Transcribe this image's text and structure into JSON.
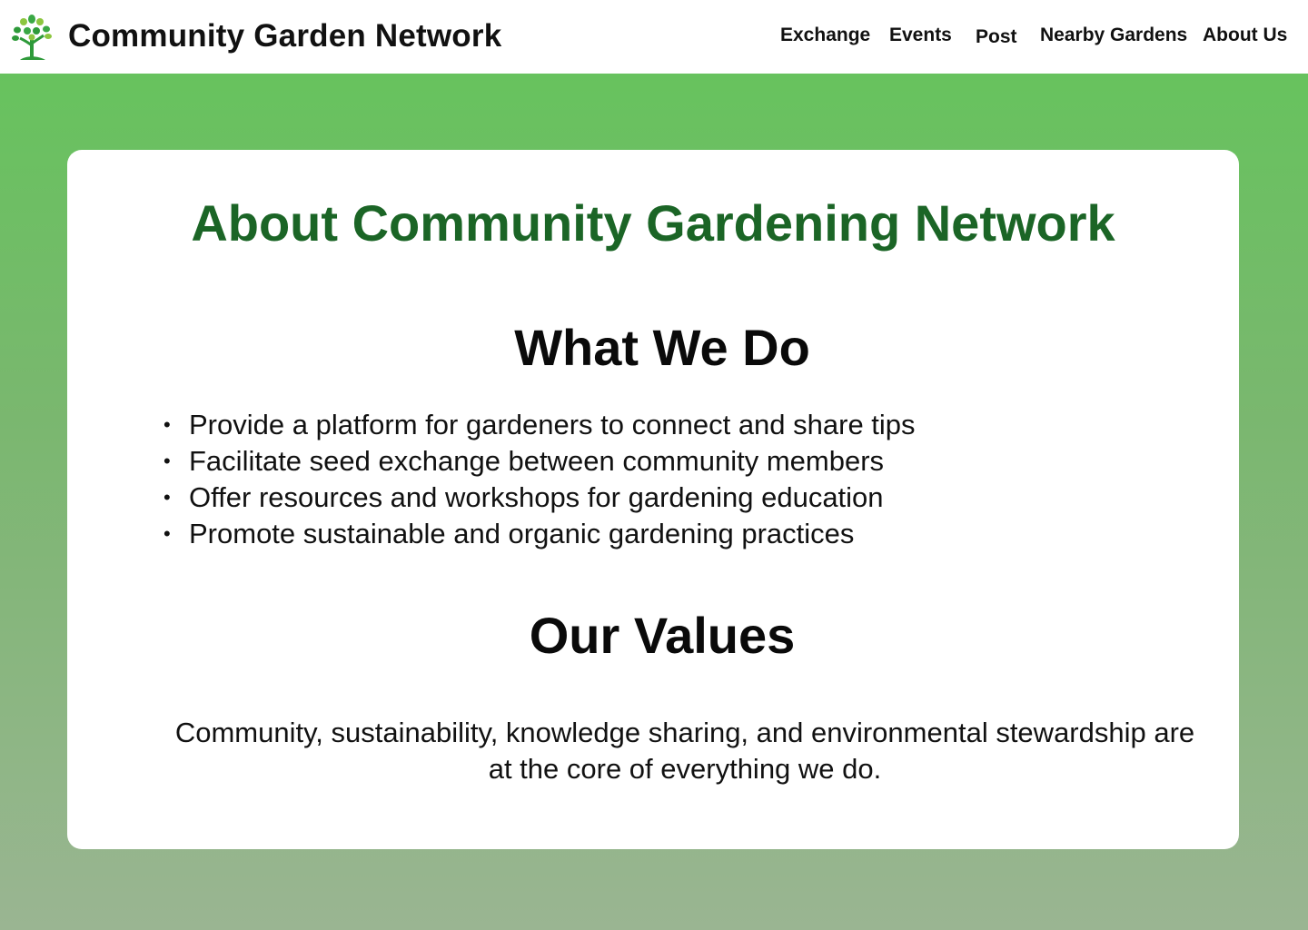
{
  "header": {
    "site_title": "Community Garden Network",
    "logo_icon": "tree-logo-icon",
    "nav": [
      {
        "label": "Exchange"
      },
      {
        "label": "Events"
      },
      {
        "label": "Post"
      },
      {
        "label": "Nearby Gardens"
      },
      {
        "label": "About Us"
      }
    ]
  },
  "main": {
    "title": "About Community Gardening Network",
    "what_we_do": {
      "heading": "What We Do",
      "items": [
        "Provide a platform for gardeners to connect and share tips",
        "Facilitate seed exchange between community members",
        "Offer resources and workshops for gardening education",
        "Promote sustainable and organic gardening practices"
      ]
    },
    "our_values": {
      "heading": "Our Values",
      "text": "Community, sustainability, knowledge sharing, and environmental stewardship are at the core of everything we do."
    }
  },
  "colors": {
    "accent_green": "#1b6526",
    "background_top": "#63c55a",
    "background_bottom": "#9ab592"
  }
}
